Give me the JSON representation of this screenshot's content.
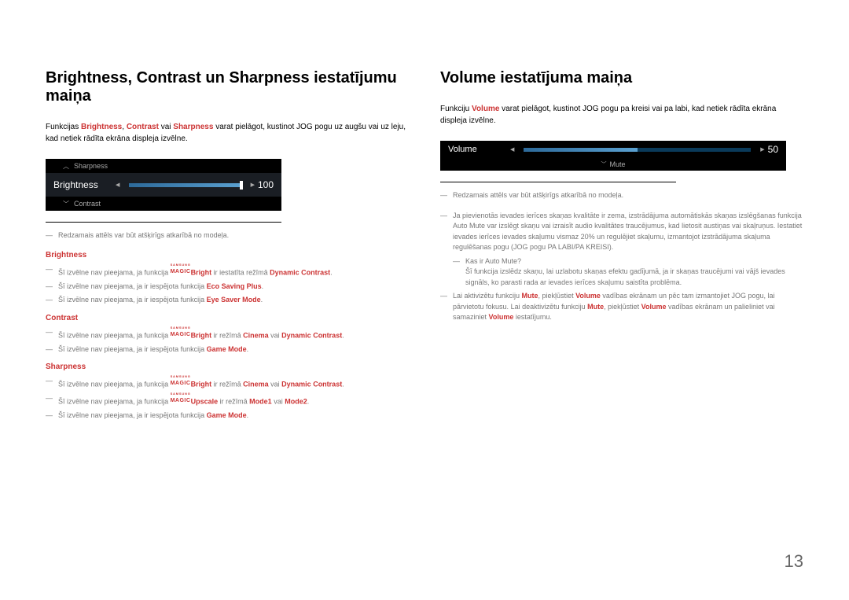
{
  "left": {
    "heading": "Brightness, Contrast un Sharpness iestatījumu maiņa",
    "intro_parts": {
      "p1": "Funkcijas ",
      "s1": "Brightness",
      "p2": ", ",
      "s2": "Contrast",
      "p3": " vai ",
      "s3": "Sharpness",
      "p4": " varat pielāgot, kustinot JOG pogu uz augšu vai uz leju, kad netiek rādīta ekrāna displeja izvēlne."
    },
    "osd": {
      "up_label": "Sharpness",
      "main_label": "Brightness",
      "value": "100",
      "down_label": "Contrast"
    },
    "note_model": "Redzamais attēls var būt atšķirīgs atkarībā no modeļa.",
    "section_brightness": {
      "title": "Brightness",
      "n1_a": "Šī izvēlne nav pieejama, ja funkcija ",
      "n1_bright": "Bright",
      "n1_b": " ir iestatīta režīmā ",
      "n1_dc": "Dynamic Contrast",
      "n1_c": ".",
      "n2_a": "Šī izvēlne nav pieejama, ja ir iespējota funkcija ",
      "n2_esp": "Eco Saving Plus",
      "n2_b": ".",
      "n3_a": "Šī izvēlne nav pieejama, ja ir iespējota funkcija ",
      "n3_esm": "Eye Saver Mode",
      "n3_b": "."
    },
    "section_contrast": {
      "title": "Contrast",
      "n1_a": "Šī izvēlne nav pieejama, ja funkcija ",
      "n1_bright": "Bright",
      "n1_b": " ir režīmā ",
      "n1_cinema": "Cinema",
      "n1_c": " vai ",
      "n1_dc": "Dynamic Contrast",
      "n1_d": ".",
      "n2_a": "Šī izvēlne nav pieejama, ja ir iespējota funkcija ",
      "n2_gm": "Game Mode",
      "n2_b": "."
    },
    "section_sharpness": {
      "title": "Sharpness",
      "n1_a": "Šī izvēlne nav pieejama, ja funkcija ",
      "n1_bright": "Bright",
      "n1_b": " ir režīmā ",
      "n1_cinema": "Cinema",
      "n1_c": " vai ",
      "n1_dc": "Dynamic Contrast",
      "n1_d": ".",
      "n2_a": "Šī izvēlne nav pieejama, ja funkcija ",
      "n2_upscale": "Upscale",
      "n2_b": " ir režīmā ",
      "n2_m1": "Mode1",
      "n2_c": " vai ",
      "n2_m2": "Mode2",
      "n2_d": ".",
      "n3_a": "Šī izvēlne nav pieejama, ja ir iespējota funkcija ",
      "n3_gm": "Game Mode",
      "n3_b": "."
    }
  },
  "right": {
    "heading": "Volume iestatījuma maiņa",
    "intro_a": "Funkciju ",
    "intro_vol": "Volume",
    "intro_b": " varat pielāgot, kustinot JOG pogu pa kreisi vai pa labi, kad netiek rādīta ekrāna displeja izvēlne.",
    "osd": {
      "label": "Volume",
      "value": "50",
      "mute": "Mute"
    },
    "note_model": "Redzamais attēls var būt atšķirīgs atkarībā no modeļa.",
    "note_automute": "Ja pievienotās ievades ierīces skaņas kvalitāte ir zema, izstrādājuma automātiskās skaņas izslēgšanas funkcija Auto Mute var izslēgt skaņu vai izraisīt audio kvalitātes traucējumus, kad lietosit austiņas vai skaļruņus. Iestatiet ievades ierīces ievades skaļumu vismaz 20% un regulējiet skaļumu, izmantojot izstrādājuma skaļuma regulēšanas pogu (JOG pogu PA LABI/PA KREISI).",
    "what_is": "Kas ir Auto Mute?",
    "what_is_desc": "Šī funkcija izslēdz skaņu, lai uzlabotu skaņas efektu gadījumā, ja ir skaņas traucējumi vai vājš ievades signāls, ko parasti rada ar ievades ierīces skaļumu saistīta problēma.",
    "note3_a": "Lai aktivizētu funkciju ",
    "note3_mute": "Mute",
    "note3_b": ", piekļūstiet ",
    "note3_vol": "Volume",
    "note3_c": " vadības ekrānam un pēc tam izmantojiet JOG pogu, lai pārvietotu fokusu.",
    "note3_d": "Lai deaktivizētu funkciju ",
    "note3_mute2": "Mute",
    "note3_e": ", piekļūstiet ",
    "note3_vol2": "Volume",
    "note3_f": " vadības ekrānam un palieliniet vai samaziniet ",
    "note3_vol3": "Volume",
    "note3_g": " iestatījumu."
  },
  "page_number": "13",
  "magic": {
    "samsung": "SAMSUNG",
    "magic": "MAGIC"
  }
}
